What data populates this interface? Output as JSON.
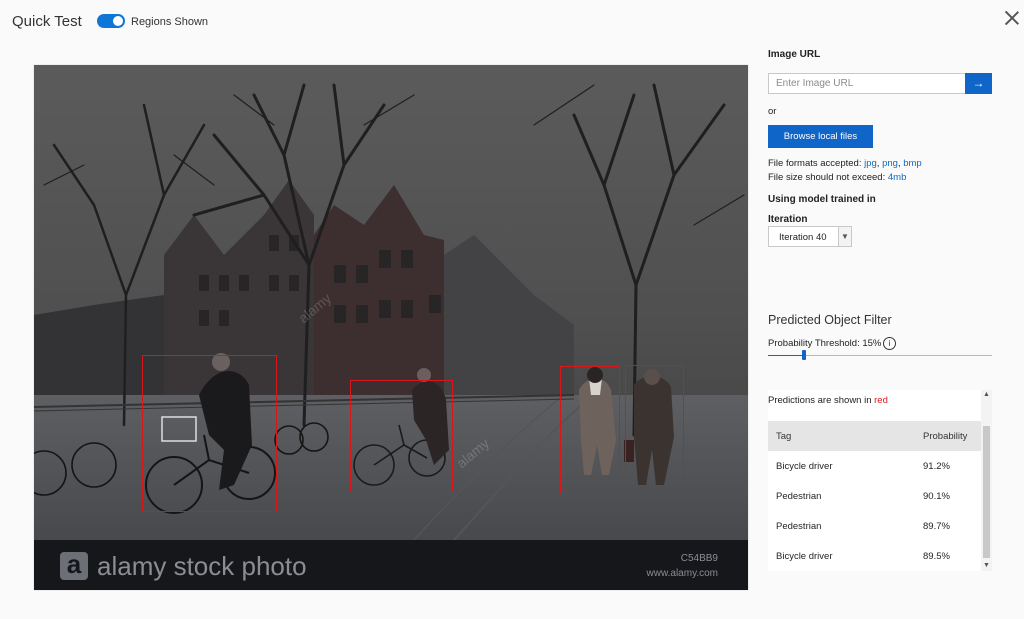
{
  "header": {
    "title": "Quick Test",
    "regions_toggle_label": "Regions Shown",
    "regions_toggle_on": true
  },
  "image": {
    "watermark_brand": "alamy stock photo",
    "watermark_logo_letter": "a",
    "watermark_id": "C54BB9",
    "watermark_url": "www.alamy.com",
    "overlay_watermark": "alamy"
  },
  "sidebar": {
    "image_url_label": "Image URL",
    "image_url_placeholder": "Enter Image URL",
    "go_icon": "arrow-right",
    "or_text": "or",
    "browse_button": "Browse local files",
    "formats_prefix": "File formats accepted: ",
    "formats": [
      "jpg",
      "png",
      "bmp"
    ],
    "size_prefix": "File size should not exceed: ",
    "size_limit": "4mb",
    "model_label": "Using model trained in",
    "iteration_label": "Iteration",
    "iteration_value": "Iteration 40",
    "filter_title": "Predicted Object Filter",
    "threshold_label": "Probability Threshold: 15%",
    "threshold_value": 15,
    "predictions_note_prefix": "Predictions are shown in ",
    "predictions_note_color_word": "red",
    "table": {
      "headers": [
        "Tag",
        "Probability"
      ],
      "rows": [
        {
          "tag": "Bicycle driver",
          "probability": "91.2%"
        },
        {
          "tag": "Pedestrian",
          "probability": "90.1%"
        },
        {
          "tag": "Pedestrian",
          "probability": "89.7%"
        },
        {
          "tag": "Bicycle driver",
          "probability": "89.5%"
        }
      ]
    }
  },
  "colors": {
    "accent": "#0f65c8",
    "region_box": "#d9161a",
    "prediction_red": "#e0191a"
  }
}
